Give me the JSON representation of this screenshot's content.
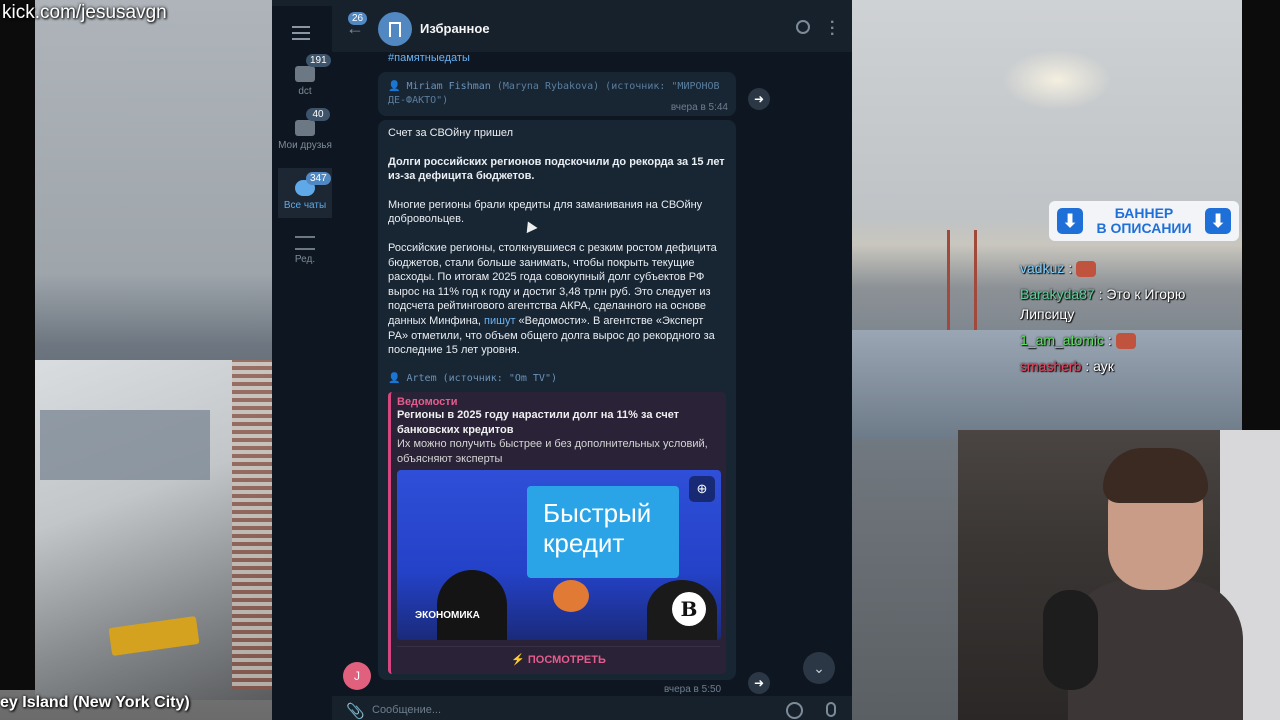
{
  "overlay": {
    "kick_url": "kick.com/jesusavgn",
    "location": "ey Island (New York City)"
  },
  "banner": {
    "line1": "БАННЕР",
    "line2": "В ОПИСАНИИ",
    "arrow_icon": "download-arrow-icon"
  },
  "stream_chat": [
    {
      "user": "vadkuz",
      "user_color": "#7fd0ff",
      "text": "",
      "has_emote": true
    },
    {
      "user": "Barakyda87",
      "user_color": "#5fd19a",
      "text": "Это к Игорю Липсицу",
      "has_emote": false
    },
    {
      "user": "1_am_atomic",
      "user_color": "#5fe060",
      "text": "",
      "has_emote": true
    },
    {
      "user": "smasherb",
      "user_color": "#e0485e",
      "text": "аук",
      "has_emote": false
    }
  ],
  "telegram": {
    "folders": [
      {
        "label": "dct",
        "badge": "191"
      },
      {
        "label": "Мои друзья",
        "badge": "40"
      },
      {
        "label": "Все чаты",
        "badge": "347",
        "active": true
      },
      {
        "label": "Ред.",
        "badge": ""
      }
    ],
    "header": {
      "back_badge": "26",
      "title": "Избранное"
    },
    "messages": {
      "hashtag": "#памятныедаты",
      "msg1_forward_name": "Miriam Fishman",
      "msg1_forward_rest": "(Maryna Rybakova) (источник: \"МИРОНОВ ДЕ-ФАКТО\")",
      "msg1_time": "вчера в 5:44",
      "msg2_p1": "Счет за СВОйну пришел",
      "msg2_p2": "Долги российских регионов подскочили до рекорда за 15 лет из-за дефицита бюджетов.",
      "msg2_p3": "Многие регионы брали кредиты для заманивания на СВОйну добровольцев.",
      "msg2_p4_a": "Российские регионы, столкнувшиеся с резким ростом дефицита бюджетов, стали больше занимать, чтобы покрыть текущие расходы. По итогам 2025 года совокупный долг субъектов РФ вырос на 11% год к году и достиг 3,48 трлн руб. Это следует из подсчета рейтингового агентства АКРА, сделанного на основе данных Минфина, ",
      "msg2_p4_link": "пишут",
      "msg2_p4_b": " «Ведомости». В агентстве «Эксперт РА» отметили, что объем общего долга вырос до рекордного за последние 15 лет уровня.",
      "msg2_forward": "Artem (источник: \"Om TV\")",
      "msg2_time": "вчера в 5:50"
    },
    "preview": {
      "site": "Ведомости",
      "title": "Регионы в 2025 году нарастили долг на 11% за счет банковских кредитов",
      "description": "Их можно получить быстрее и без дополнительных условий, объясняют эксперты",
      "image_card": "Быстрый кредит",
      "image_section": "ЭКОНОМИКА",
      "image_logo": "B",
      "button": "ПОСМОТРЕТЬ"
    },
    "avatar_letter": "J",
    "composer_placeholder": "Сообщение..."
  }
}
